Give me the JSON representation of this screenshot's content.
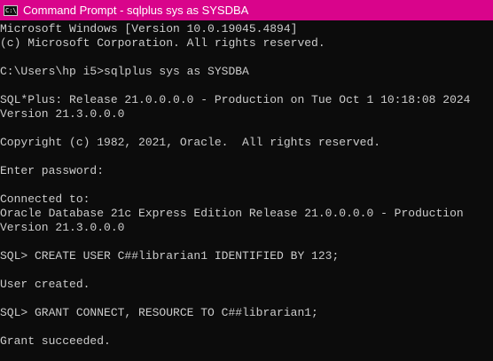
{
  "window": {
    "title": "Command Prompt - sqlplus  sys as SYSDBA",
    "icon": "cmd-icon",
    "icon_text": "C:\\_",
    "title_bar_color": "#d9048b",
    "background_color": "#0c0c0c",
    "text_color": "#cccccc"
  },
  "console": {
    "lines": [
      "Microsoft Windows [Version 10.0.19045.4894]",
      "(c) Microsoft Corporation. All rights reserved.",
      "",
      "C:\\Users\\hp i5>sqlplus sys as SYSDBA",
      "",
      "SQL*Plus: Release 21.0.0.0.0 - Production on Tue Oct 1 10:18:08 2024",
      "Version 21.3.0.0.0",
      "",
      "Copyright (c) 1982, 2021, Oracle.  All rights reserved.",
      "",
      "Enter password:",
      "",
      "Connected to:",
      "Oracle Database 21c Express Edition Release 21.0.0.0.0 - Production",
      "Version 21.3.0.0.0",
      "",
      "SQL> CREATE USER C##librarian1 IDENTIFIED BY 123;",
      "",
      "User created.",
      "",
      "SQL> GRANT CONNECT, RESOURCE TO C##librarian1;",
      "",
      "Grant succeeded."
    ]
  }
}
